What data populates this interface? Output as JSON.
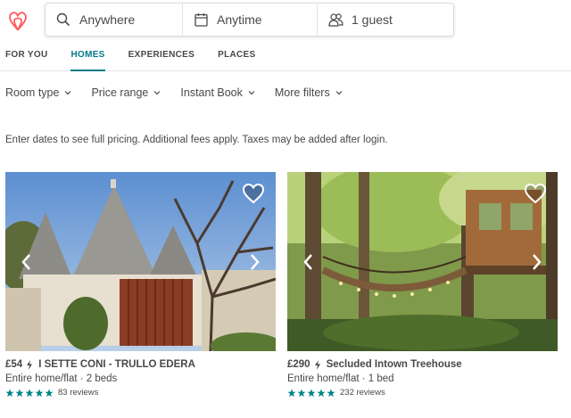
{
  "brand": {
    "accent": "#ff5a5f",
    "teal": "#008489"
  },
  "search": {
    "where": "Anywhere",
    "when": "Anytime",
    "guests": "1 guest"
  },
  "tabs": [
    "FOR YOU",
    "HOMES",
    "EXPERIENCES",
    "PLACES"
  ],
  "active_tab": "HOMES",
  "filters": [
    "Room type",
    "Price range",
    "Instant Book",
    "More filters"
  ],
  "notice": "Enter dates to see full pricing. Additional fees apply. Taxes may be added after login.",
  "listings": [
    {
      "price": "£54",
      "name": "I SETTE CONI - TRULLO EDERA",
      "details": "Entire home/flat · 2 beds",
      "stars": 5,
      "reviews": "83 reviews"
    },
    {
      "price": "£290",
      "name": "Secluded Intown Treehouse",
      "details": "Entire home/flat · 1 bed",
      "stars": 5,
      "reviews": "232 reviews"
    }
  ]
}
